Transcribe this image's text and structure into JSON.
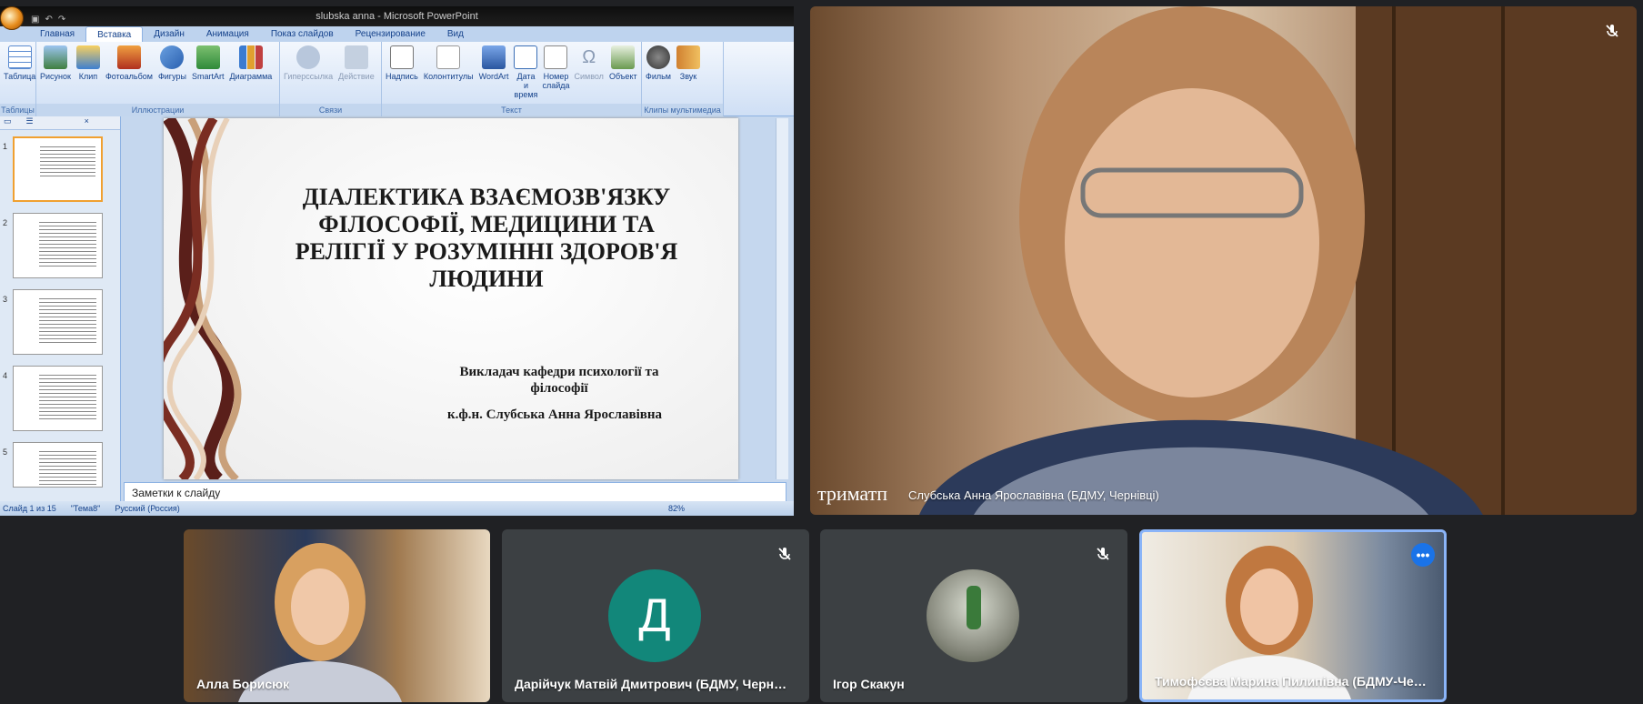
{
  "powerpoint": {
    "window_title": "slubska anna - Microsoft PowerPoint",
    "tabs": [
      "Главная",
      "Вставка",
      "Дизайн",
      "Анимация",
      "Показ слайдов",
      "Рецензирование",
      "Вид"
    ],
    "active_tab": "Вставка",
    "groups": [
      {
        "label": "Таблицы",
        "buttons": [
          "Таблица"
        ]
      },
      {
        "label": "Иллюстрации",
        "buttons": [
          "Рисунок",
          "Клип",
          "Фотоальбом",
          "Фигуры",
          "SmartArt",
          "Диаграмма"
        ]
      },
      {
        "label": "Связи",
        "buttons": [
          "Гиперссылка",
          "Действие"
        ]
      },
      {
        "label": "Текст",
        "buttons": [
          "Надпись",
          "Колонтитулы",
          "WordArt",
          "Дата и время",
          "Номер слайда",
          "Символ",
          "Объект"
        ]
      },
      {
        "label": "Клипы мультимедиа",
        "buttons": [
          "Фильм",
          "Звук"
        ]
      }
    ],
    "slide": {
      "title": "ДІАЛЕКТИКА ВЗАЄМОЗВ'ЯЗКУ ФІЛОСОФІЇ, МЕДИЦИНИ ТА РЕЛІГІЇ У РОЗУМІННІ ЗДОРОВ'Я ЛЮДИНИ",
      "subtitle1": "Викладач кафедри психології та філософії",
      "subtitle2": "к.ф.н. Слубська Анна Ярославівна"
    },
    "thumb_numbers": [
      "1",
      "2",
      "3",
      "4",
      "5"
    ],
    "notes_placeholder": "Заметки к слайду",
    "status": {
      "slide": "Слайд 1 из 15",
      "theme": "\"Тема8\"",
      "language": "Русский (Россия)",
      "zoom": "82%"
    }
  },
  "main_speaker": {
    "name": "Слубська Анна Ярославівна (БДМУ, Чернівці)",
    "caption": "триматп"
  },
  "participants": [
    {
      "name": "Алла Борисюк",
      "type": "video",
      "muted": false
    },
    {
      "name": "Дарійчук Матвій Дмитрович (БДМУ, Черні...",
      "type": "initial",
      "initial": "Д",
      "avatar_color": "#12877a",
      "muted": true
    },
    {
      "name": "Ігор Скакун",
      "type": "photo",
      "muted": true
    },
    {
      "name": "Тимофєєва Марина Пилипівна (БДМУ-Черн...",
      "type": "video",
      "muted": false,
      "active": true
    }
  ]
}
